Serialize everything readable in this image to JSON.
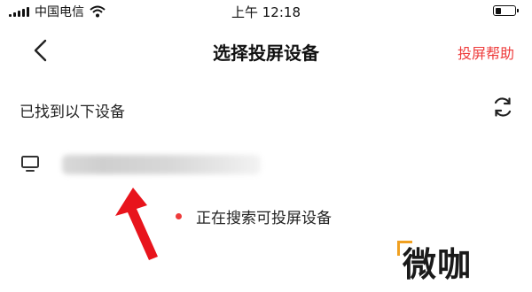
{
  "status_bar": {
    "carrier": "中国电信",
    "time": "上午 12:18",
    "battery_level": 0.3,
    "icons": [
      "signal-icon",
      "wifi-icon",
      "battery-icon"
    ]
  },
  "nav": {
    "back_icon": "chevron-left-icon",
    "title": "选择投屏设备",
    "help_label": "投屏帮助"
  },
  "devices_section": {
    "label": "已找到以下设备",
    "refresh_icon": "refresh-icon",
    "devices": [
      {
        "icon": "tv-icon",
        "name_obscured": true
      }
    ]
  },
  "search_status": {
    "text": "正在搜索可投屏设备"
  },
  "annotation": {
    "arrow_color": "#e8141c"
  },
  "watermark": {
    "text": "微咖"
  },
  "colors": {
    "accent": "#ee3b3b",
    "text": "#222222",
    "background": "#ffffff"
  }
}
